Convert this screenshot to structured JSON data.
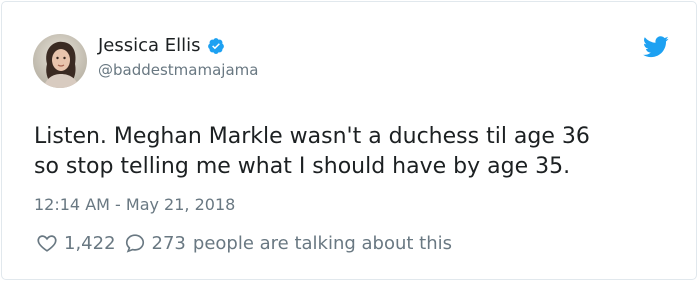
{
  "author": {
    "name": "Jessica Ellis",
    "handle": "@baddestmamajama",
    "verified": true,
    "avatar_icon": "user-avatar-photo"
  },
  "tweet": {
    "lines": [
      "Listen. Meghan Markle wasn't a duchess til age 36",
      "so stop telling me what I should have by age 35."
    ],
    "timestamp": "12:14 AM - May 21, 2018"
  },
  "actions": {
    "likes_count": "1,422",
    "talking_count": "273",
    "talking_label": "people are talking about this"
  },
  "colors": {
    "twitter_blue": "#1da1f2",
    "text_primary": "#1c2022",
    "text_secondary": "#697882",
    "border": "#e1e8ed"
  },
  "icons": {
    "verified": "verified-badge-icon",
    "brand": "twitter-bird-icon",
    "like": "heart-icon",
    "reply": "speech-bubble-icon"
  }
}
